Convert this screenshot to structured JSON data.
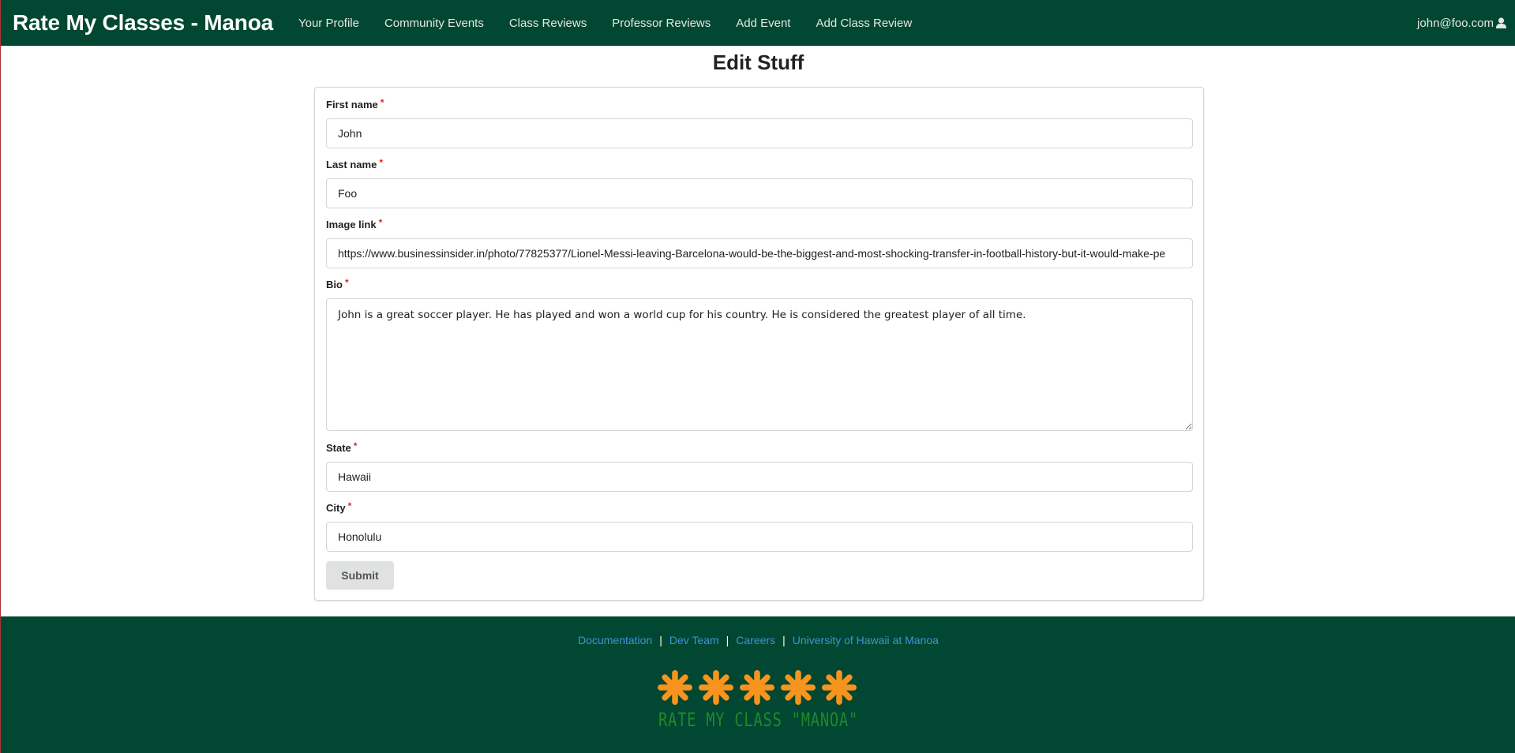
{
  "navbar": {
    "brand": "Rate My Classes - Manoa",
    "items": [
      {
        "label": "Your Profile"
      },
      {
        "label": "Community Events"
      },
      {
        "label": "Class Reviews"
      },
      {
        "label": "Professor Reviews"
      },
      {
        "label": "Add Event"
      },
      {
        "label": "Add Class Review"
      }
    ],
    "user": "john@foo.com",
    "user_icon": "user-icon"
  },
  "page": {
    "title": "Edit Stuff"
  },
  "form": {
    "required_marker": "*",
    "first_name": {
      "label": "First name",
      "value": "John"
    },
    "last_name": {
      "label": "Last name",
      "value": "Foo"
    },
    "image_link": {
      "label": "Image link",
      "value": "https://www.businessinsider.in/photo/77825377/Lionel-Messi-leaving-Barcelona-would-be-the-biggest-and-most-shocking-transfer-in-football-history-but-it-would-make-pe"
    },
    "bio": {
      "label": "Bio",
      "value": "John is a great soccer player. He has played and won a world cup for his country. He is considered the greatest player of all time."
    },
    "state": {
      "label": "State",
      "value": "Hawaii"
    },
    "city": {
      "label": "City",
      "value": "Honolulu"
    },
    "submit_label": "Submit"
  },
  "footer": {
    "links": [
      {
        "label": "Documentation"
      },
      {
        "label": "Dev Team"
      },
      {
        "label": "Careers"
      },
      {
        "label": "University of Hawaii at Manoa"
      }
    ],
    "separator": "|",
    "logo_text": "RATE MY CLASS \"MANOA\"",
    "logo_star_count": 5
  },
  "colors": {
    "navbar_bg": "#024731",
    "link": "#3b95d6",
    "star": "#f7941d",
    "logo_text": "#1d8a2c",
    "required": "#db2828"
  }
}
